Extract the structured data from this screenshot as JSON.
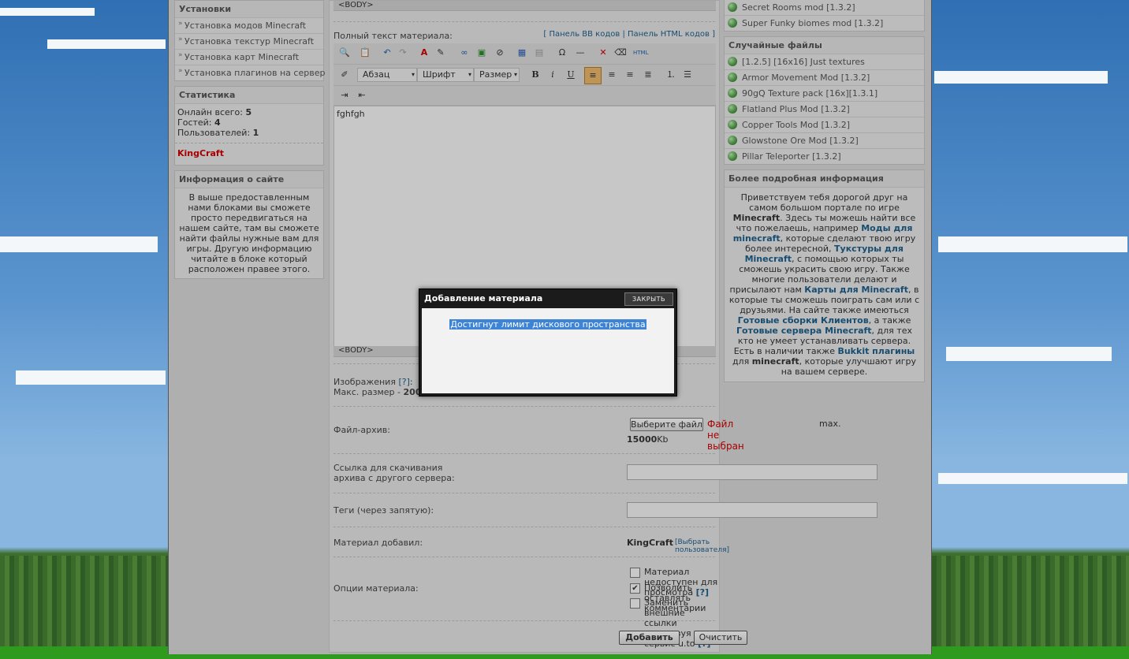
{
  "left": {
    "installs": {
      "title": "Установки",
      "items": [
        "Установка модов Minecraft",
        "Установка текстур Minecraft",
        "Установка карт Minecraft",
        "Установка плагинов на сервер"
      ]
    },
    "stats": {
      "title": "Статистика",
      "online_label": "Онлайн всего:",
      "online": "5",
      "guests_label": "Гостей:",
      "guests": "4",
      "users_label": "Пользователей:",
      "users": "1",
      "user": "KingCraft"
    },
    "about": {
      "title": "Информация о сайте",
      "text": "В выше предоставленным нами блоками вы сможете просто передвигаться на нашем сайте, там вы сможете найти файлы нужные вам для игры. Другую информацию читайте в блоке который расположен правее этого."
    }
  },
  "center": {
    "body_tag_top": "<BODY>",
    "fulltext_label": "Полный текст материала:",
    "panel_links": {
      "bb": "Панель BB кодов",
      "html": "Панель HTML кодов"
    },
    "format_options": {
      "paragraph": "Абзац",
      "font": "Шрифт",
      "size": "Размер"
    },
    "toolbar_icons": [
      "find-replace-icon",
      "paste-icon",
      "undo-icon",
      "redo-icon",
      "text-color-icon",
      "bg-color-icon",
      "link-icon",
      "image-icon",
      "unlink-icon",
      "table-icon",
      "table-edit-icon",
      "special-char-icon",
      "hr-icon",
      "remove-format-icon",
      "eraser-icon",
      "html-icon"
    ],
    "editor_text": "fghfgh",
    "body_tag_bottom": "<BODY>",
    "images_label": "Изображения",
    "images_help": "[?]",
    "max_size_label": "Макс. размер -",
    "max_size_value": "2000",
    "archive_label": "Файл-архив:",
    "choose_file": "Выберите файл",
    "no_file": "Файл не выбран",
    "max_label": "max.",
    "archive_max": "15000",
    "archive_unit": "Kb",
    "link_label": "Ссылка для скачивания архива с другого сервера:",
    "link_value": "",
    "tags_label": "Теги (через запятую):",
    "tags_value": "",
    "added_by_label": "Материал добавил:",
    "added_by": "KingCraft",
    "choose_user": "[Выбрать пользователя]",
    "options_label": "Опции материала:",
    "options": [
      {
        "label": "Материал недоступен для просмотра",
        "help": "[?]",
        "checked": false
      },
      {
        "label": "Позволить оставлять комментарии",
        "help": "",
        "checked": true
      },
      {
        "label": "Заменить внешние ссылки используя сервис u.to",
        "help": "[?]",
        "checked": false
      }
    ],
    "submit": "Добавить",
    "clear": "Очистить"
  },
  "right": {
    "top_files": [
      "Secret Rooms mod [1.3.2]",
      "Super Funky biomes mod [1.3.2]"
    ],
    "random": {
      "title": "Случайные файлы",
      "items": [
        "[1.2.5] [16x16] Just textures",
        "Armor Movement Mod [1.3.2]",
        "90gQ Texture pack [16x][1.3.1]",
        "Flatland Plus Mod [1.3.2]",
        "Copper Tools Mod [1.3.2]",
        "Glowstone Ore Mod [1.3.2]",
        "Pillar Teleporter [1.3.2]"
      ]
    },
    "more": {
      "title": "Более подробная информация",
      "parts": [
        "Приветствуем тебя дорогой друг на самом большом портале по игре ",
        "Minecraft",
        ". Здесь ты можешь найти все что пожелаешь, например ",
        "Моды для minecraft",
        ", которые сделают твою игру более интересной, ",
        "Тукстуры для Minecraft",
        ", с помощью которых ты сможешь украсить свою игру. Также многие пользователи делают и присылают нам ",
        "Карты для Minecraft",
        ", в которые ты сможешь поиграть сам или с друзьями. На сайте также имеються ",
        "Готовые сборки Клиентов",
        ", а также ",
        "Готовые сервера Minecraft",
        ", для тех кто не умеет устанавливать сервера. Есть в наличии также ",
        "Bukkit плагины",
        " для ",
        "minecraft",
        ", которые улучшают игру на вашем сервере."
      ]
    }
  },
  "modal": {
    "title": "Добавление материала",
    "close": "ЗАКРЫТЬ",
    "message": "Достигнут лимит дискового пространства"
  },
  "colors": {
    "link": "#1d5e8a",
    "user": "#cc0000",
    "modal_bar": "#1b1b1b",
    "selection": "#3d84d6"
  }
}
